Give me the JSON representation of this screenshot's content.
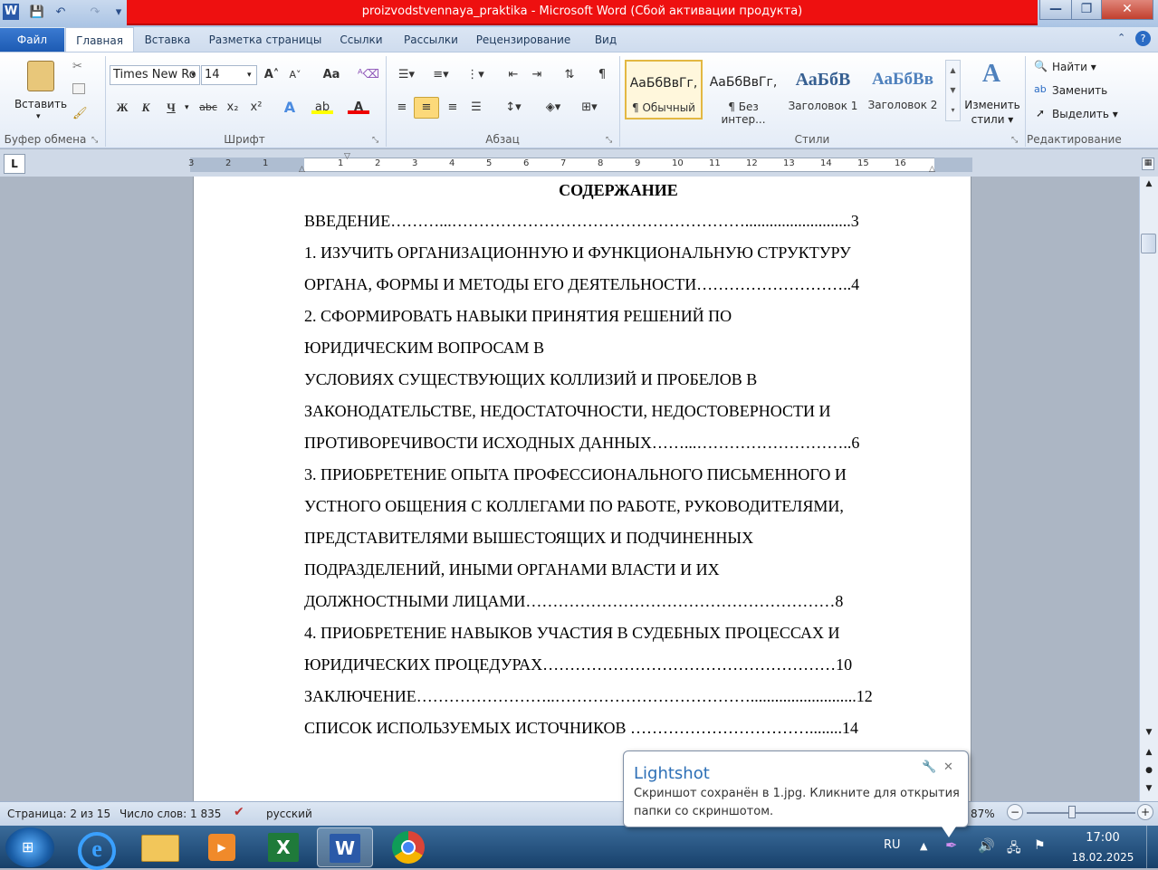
{
  "window": {
    "title": "proizvodstvennaya_praktika - Microsoft Word (Сбой активации продукта)",
    "app_icon": "W",
    "minimize": "—",
    "maximize": "❐",
    "close": "✕"
  },
  "quick_access": {
    "save_icon": "💾",
    "undo_icon": "↶",
    "redo_icon": "↷",
    "customize_icon": "▾"
  },
  "tabs": {
    "file": "Файл",
    "home": "Главная",
    "items": [
      "Вставка",
      "Разметка страницы",
      "Ссылки",
      "Рассылки",
      "Рецензирование",
      "Вид"
    ]
  },
  "ribbon": {
    "clipboard": {
      "paste": "Вставить",
      "label": "Буфер обмена"
    },
    "font": {
      "name": "Times New Ro",
      "size": "14",
      "label": "Шрифт",
      "bold": "Ж",
      "italic": "К",
      "underline": "Ч",
      "strike": "abc",
      "sub": "x₂",
      "sup": "x²",
      "grow": "A˄",
      "shrink": "A˅",
      "case": "Aa"
    },
    "paragraph": {
      "label": "Абзац",
      "pilcrow": "¶"
    },
    "styles": {
      "label": "Стили",
      "items": [
        {
          "preview": "АаБбВвГг,",
          "name": "¶ Обычный"
        },
        {
          "preview": "АаБбВвГг,",
          "name": "¶ Без интер..."
        },
        {
          "preview": "АаБбВ",
          "name": "Заголовок 1"
        },
        {
          "preview": "АаБбВв",
          "name": "Заголовок 2"
        }
      ],
      "change_styles": [
        "Изменить",
        "стили ▾"
      ]
    },
    "editing": {
      "label": "Редактирование",
      "find": "Найти ▾",
      "replace": "Заменить",
      "select": "Выделить ▾"
    }
  },
  "ruler": {
    "tab_icon": "L",
    "numbers_left": [
      "3",
      "2",
      "1"
    ],
    "numbers_right": [
      "1",
      "2",
      "3",
      "4",
      "5",
      "6",
      "7",
      "8",
      "9",
      "10",
      "11",
      "12",
      "13",
      "14",
      "15",
      "16"
    ]
  },
  "document": {
    "heading": "СОДЕРЖАНИЕ",
    "lines": [
      "ВВЕДЕНИЕ………...………………………………………………..........................3",
      "1. ИЗУЧИТЬ ОРГАНИЗАЦИОННУЮ И ФУНКЦИОНАЛЬНУЮ СТРУКТУРУ",
      "ОРГАНА,  ФОРМЫ И МЕТОДЫ ЕГО ДЕЯТЕЛЬНОСТИ………………………..4",
      "2. СФОРМИРОВАТЬ НАВЫКИ ПРИНЯТИЯ РЕШЕНИЙ ПО",
      "ЮРИДИЧЕСКИМ ВОПРОСАМ В",
      "УСЛОВИЯХ СУЩЕСТВУЮЩИХ КОЛЛИЗИЙ И ПРОБЕЛОВ В",
      "ЗАКОНОДАТЕЛЬСТВЕ, НЕДОСТАТОЧНОСТИ, НЕДОСТОВЕРНОСТИ И",
      "ПРОТИВОРЕЧИВОСТИ  ИСХОДНЫХ  ДАННЫХ……...………………………..6",
      "3. ПРИОБРЕТЕНИЕ ОПЫТА ПРОФЕССИОНАЛЬНОГО ПИСЬМЕННОГО И",
      "УСТНОГО  ОБЩЕНИЯ  С  КОЛЛЕГАМИ  ПО  РАБОТЕ,  РУКОВОДИТЕЛЯМИ,",
      "ПРЕДСТАВИТЕЛЯМИ ВЫШЕСТОЯЩИХ И ПОДЧИНЕННЫХ",
      "ПОДРАЗДЕЛЕНИЙ, ИНЫМИ ОРГАНАМИ ВЛАСТИ И ИХ",
      "ДОЛЖНОСТНЫМИ  ЛИЦАМИ…………………………………………………8",
      "4. ПРИОБРЕТЕНИЕ НАВЫКОВ УЧАСТИЯ В СУДЕБНЫХ ПРОЦЕССАХ И",
      "ЮРИДИЧЕСКИХ  ПРОЦЕДУРАХ………………………………………………10",
      "ЗАКЛЮЧЕНИЕ……………………..………………………………..........................12",
      "СПИСОК  ИСПОЛЬЗУЕМЫХ  ИСТОЧНИКОВ  ……………………………........14"
    ]
  },
  "status": {
    "page": "Страница: 2 из 15",
    "words": "Число слов: 1 835",
    "language": "русский",
    "zoom": "87%",
    "zoom_minus": "−",
    "zoom_plus": "+"
  },
  "popup": {
    "title": "Lightshot",
    "message_1": "Скриншот сохранён в 1.jpg. Кликните для открытия",
    "message_2": "папки со скриншотом.",
    "close": "✕"
  },
  "taskbar": {
    "lang": "RU",
    "time": "17:00",
    "date": "18.02.2025"
  },
  "colors": {
    "title_red": "#ee1010",
    "file_tab": "#2a6bc4",
    "taskbar": "#1d4b7a"
  }
}
